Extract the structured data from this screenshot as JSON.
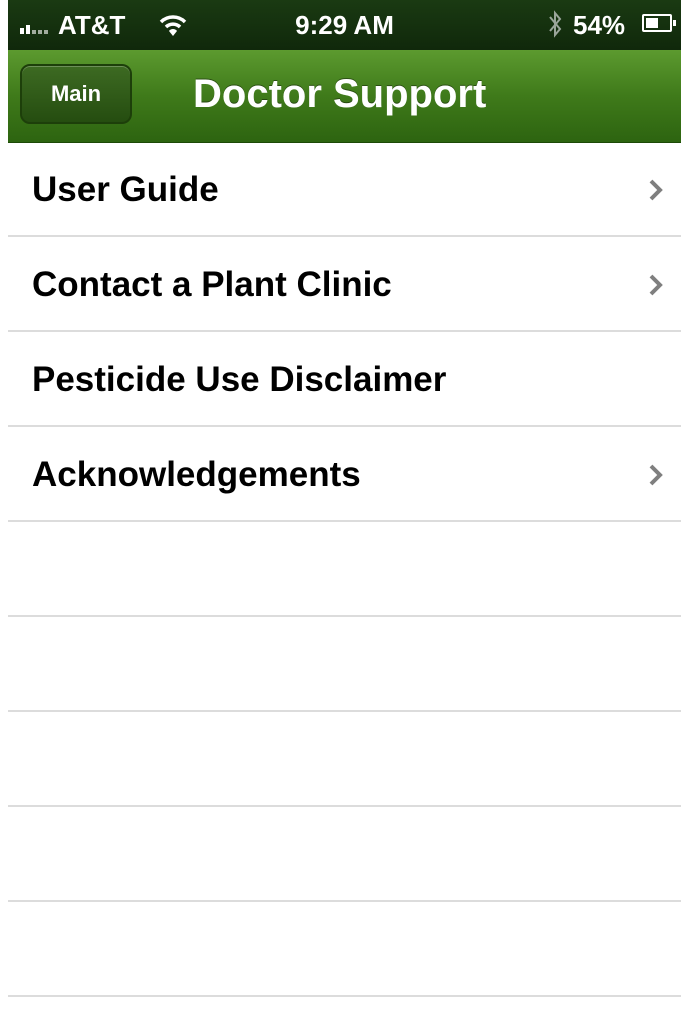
{
  "status_bar": {
    "carrier": "AT&T",
    "time": "9:29 AM",
    "battery_percent": "54%",
    "battery_level": 0.54,
    "icons": [
      "signal-icon",
      "wifi-icon",
      "bluetooth-icon",
      "battery-icon"
    ]
  },
  "navbar": {
    "back_label": "Main",
    "title": "Doctor Support",
    "color": "#3f7a1a"
  },
  "menu": {
    "items": [
      {
        "label": "User Guide",
        "chevron": true
      },
      {
        "label": "Contact a Plant Clinic",
        "chevron": true
      },
      {
        "label": "Pesticide Use Disclaimer",
        "chevron": false
      },
      {
        "label": "Acknowledgements",
        "chevron": true
      }
    ],
    "empty_rows": 5
  }
}
